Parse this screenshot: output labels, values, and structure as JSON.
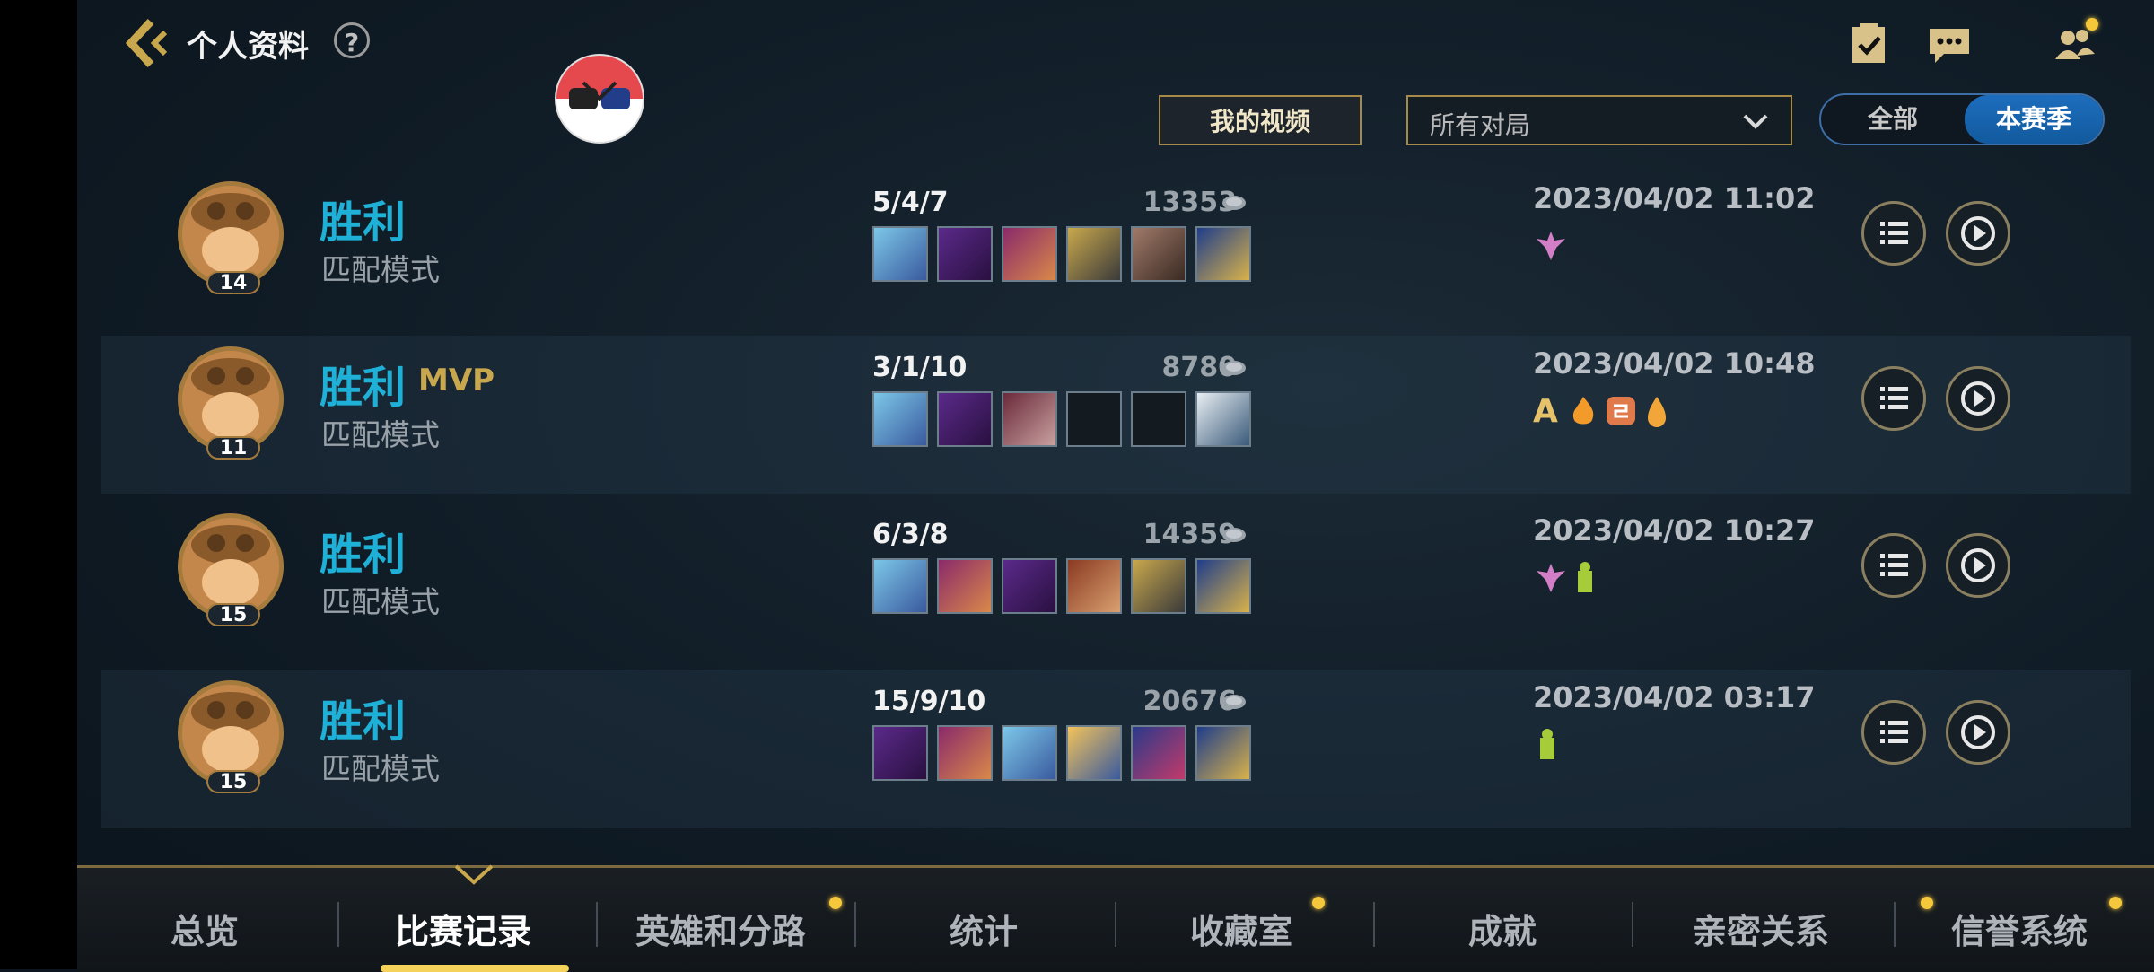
{
  "header": {
    "title": "个人资料",
    "help_icon": "?"
  },
  "controls": {
    "my_videos": "我的视频",
    "filter_value": "所有对局",
    "segment": [
      "全部",
      "本赛季"
    ],
    "segment_selected": "本赛季"
  },
  "matches": [
    {
      "result": "胜利",
      "mvp": "",
      "mode": "匹配模式",
      "level": "14",
      "kda": "5/4/7",
      "gold": "13353",
      "date": "2023/04/02 11:02"
    },
    {
      "result": "胜利",
      "mvp": "MVP",
      "mode": "匹配模式",
      "level": "11",
      "kda": "3/1/10",
      "gold": "8780",
      "date": "2023/04/02 10:48"
    },
    {
      "result": "胜利",
      "mvp": "",
      "mode": "匹配模式",
      "level": "15",
      "kda": "6/3/8",
      "gold": "14359",
      "date": "2023/04/02 10:27"
    },
    {
      "result": "胜利",
      "mvp": "",
      "mode": "匹配模式",
      "level": "15",
      "kda": "15/9/10",
      "gold": "20676",
      "date": "2023/04/02 03:17"
    }
  ],
  "badge_a": "A",
  "nav": {
    "tabs": [
      "总览",
      "比赛记录",
      "英雄和分路",
      "统计",
      "收藏室",
      "成就",
      "亲密关系",
      "信誉系统"
    ],
    "active": "比赛记录"
  },
  "colors": {
    "accent": "#1eb0d6",
    "gold": "#c9a84d",
    "tab_dot": "#f5c73a"
  }
}
